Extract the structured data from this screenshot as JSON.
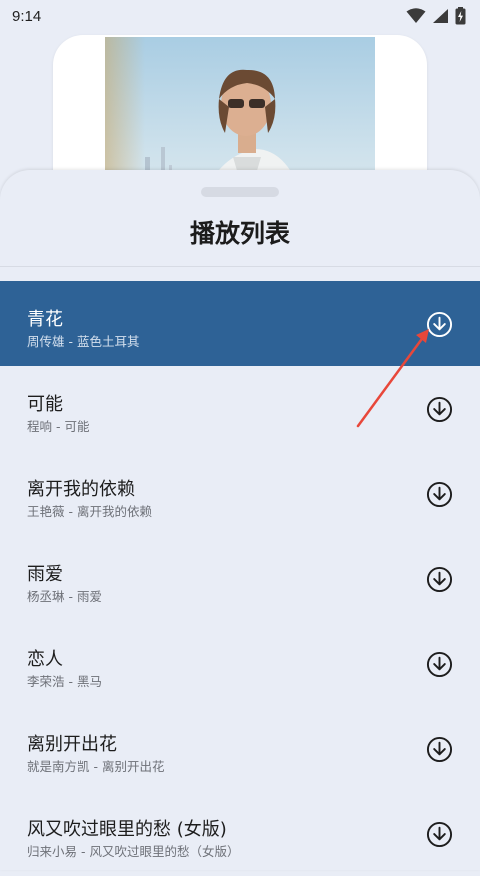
{
  "status_bar": {
    "time": "9:14",
    "icons": [
      "wifi-icon",
      "signal-icon",
      "battery-charging-icon"
    ]
  },
  "album": {
    "image": "artist-photo"
  },
  "playlist": {
    "title": "播放列表",
    "songs": [
      {
        "title": "青花",
        "subtitle": "周传雄 - 蓝色土耳其",
        "active": true
      },
      {
        "title": "可能",
        "subtitle": "程响 - 可能",
        "active": false
      },
      {
        "title": "离开我的依赖",
        "subtitle": "王艳薇 - 离开我的依赖",
        "active": false
      },
      {
        "title": "雨爱",
        "subtitle": "杨丞琳 - 雨爱",
        "active": false
      },
      {
        "title": "恋人",
        "subtitle": "李荣浩 - 黑马",
        "active": false
      },
      {
        "title": "离别开出花",
        "subtitle": "就是南方凯 - 离别开出花",
        "active": false
      },
      {
        "title": "风又吹过眼里的愁 (女版)",
        "subtitle": "归来小易 - 风又吹过眼里的愁（女版）",
        "active": false
      }
    ]
  },
  "colors": {
    "active_row": "#2e6296",
    "annotation_arrow": "#e8473a",
    "background": "#e9edf6"
  }
}
